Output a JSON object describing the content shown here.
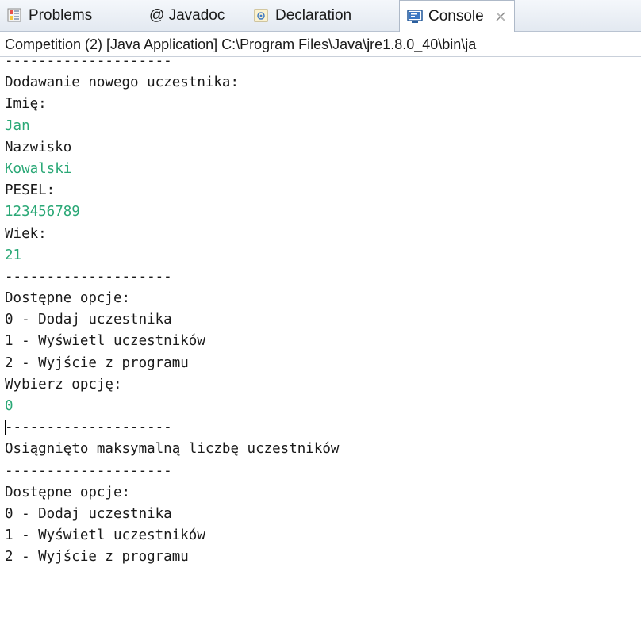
{
  "tabs": [
    {
      "label": "Problems",
      "icon": "problems-icon",
      "active": false
    },
    {
      "label": "@ Javadoc",
      "icon": "javadoc-icon",
      "active": false
    },
    {
      "label": "Declaration",
      "icon": "declaration-icon",
      "active": false
    },
    {
      "label": "Console",
      "icon": "console-icon",
      "active": true,
      "close": "✕"
    }
  ],
  "status": "Competition (2) [Java Application] C:\\Program Files\\Java\\jre1.8.0_40\\bin\\ja",
  "colors": {
    "input": "#2aa876",
    "text": "#1a1a1a"
  },
  "console": {
    "lines": [
      {
        "text": "--------------------",
        "kind": "sep"
      },
      {
        "text": "Dodawanie nowego uczestnika:",
        "kind": "out"
      },
      {
        "text": "Imię:",
        "kind": "out"
      },
      {
        "text": "Jan",
        "kind": "input"
      },
      {
        "text": "Nazwisko",
        "kind": "out"
      },
      {
        "text": "Kowalski",
        "kind": "input"
      },
      {
        "text": "PESEL:",
        "kind": "out"
      },
      {
        "text": "123456789",
        "kind": "input"
      },
      {
        "text": "Wiek:",
        "kind": "out"
      },
      {
        "text": "21",
        "kind": "input"
      },
      {
        "text": "--------------------",
        "kind": "out"
      },
      {
        "text": "Dostępne opcje:",
        "kind": "out"
      },
      {
        "text": "0 - Dodaj uczestnika",
        "kind": "out"
      },
      {
        "text": "1 - Wyświetl uczestników",
        "kind": "out"
      },
      {
        "text": "2 - Wyjście z programu",
        "kind": "out"
      },
      {
        "text": "Wybierz opcję:",
        "kind": "out"
      },
      {
        "text": "0",
        "kind": "input"
      },
      {
        "text": "--------------------",
        "kind": "caret"
      },
      {
        "text": "Osiągnięto maksymalną liczbę uczestników",
        "kind": "out"
      },
      {
        "text": "--------------------",
        "kind": "out"
      },
      {
        "text": "Dostępne opcje:",
        "kind": "out"
      },
      {
        "text": "0 - Dodaj uczestnika",
        "kind": "out"
      },
      {
        "text": "1 - Wyświetl uczestników",
        "kind": "out"
      },
      {
        "text": "2 - Wyjście z programu",
        "kind": "out"
      }
    ]
  }
}
